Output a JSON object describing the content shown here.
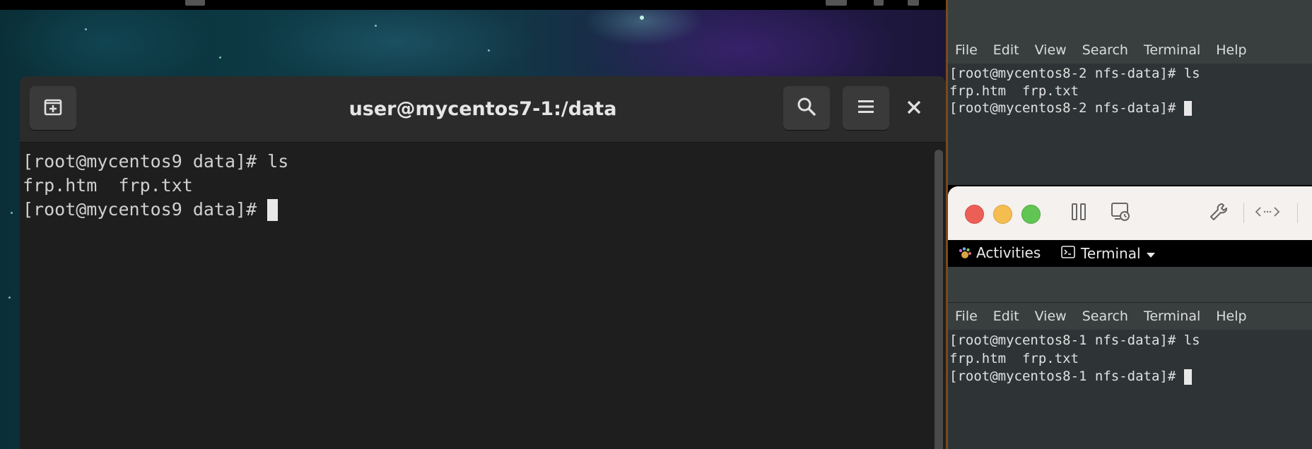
{
  "main_terminal": {
    "title": "user@mycentos7-1:/data",
    "lines": [
      "[root@mycentos9 data]# ls",
      "frp.htm  frp.txt",
      "[root@mycentos9 data]# "
    ],
    "icons": {
      "new_tab": "new-tab-icon",
      "search": "search-icon",
      "menu": "hamburger-menu-icon",
      "close": "close-icon"
    }
  },
  "terminal_top_right": {
    "menu": [
      "File",
      "Edit",
      "View",
      "Search",
      "Terminal",
      "Help"
    ],
    "lines": [
      "[root@mycentos8-2 nfs-data]# ls",
      "frp.htm  frp.txt",
      "[root@mycentos8-2 nfs-data]# "
    ]
  },
  "vm_toolbar": {
    "icons": [
      "close-light",
      "minimize-light",
      "zoom-light",
      "pause-icon",
      "snapshot-icon",
      "wrench-icon",
      "code-arrows-icon"
    ]
  },
  "activities_bar": {
    "activities_label": "Activities",
    "app_label": "Terminal"
  },
  "terminal_bottom_right": {
    "menu": [
      "File",
      "Edit",
      "View",
      "Search",
      "Terminal",
      "Help"
    ],
    "lines": [
      "[root@mycentos8-1 nfs-data]# ls",
      "frp.htm  frp.txt",
      "[root@mycentos8-1 nfs-data]# "
    ]
  },
  "colors": {
    "main_bg": "#1e1e1e",
    "gnome_term_bg": "#2e3436",
    "close_light": "#ec5f57",
    "minimize_light": "#f5bd4f",
    "zoom_light": "#61c554"
  }
}
